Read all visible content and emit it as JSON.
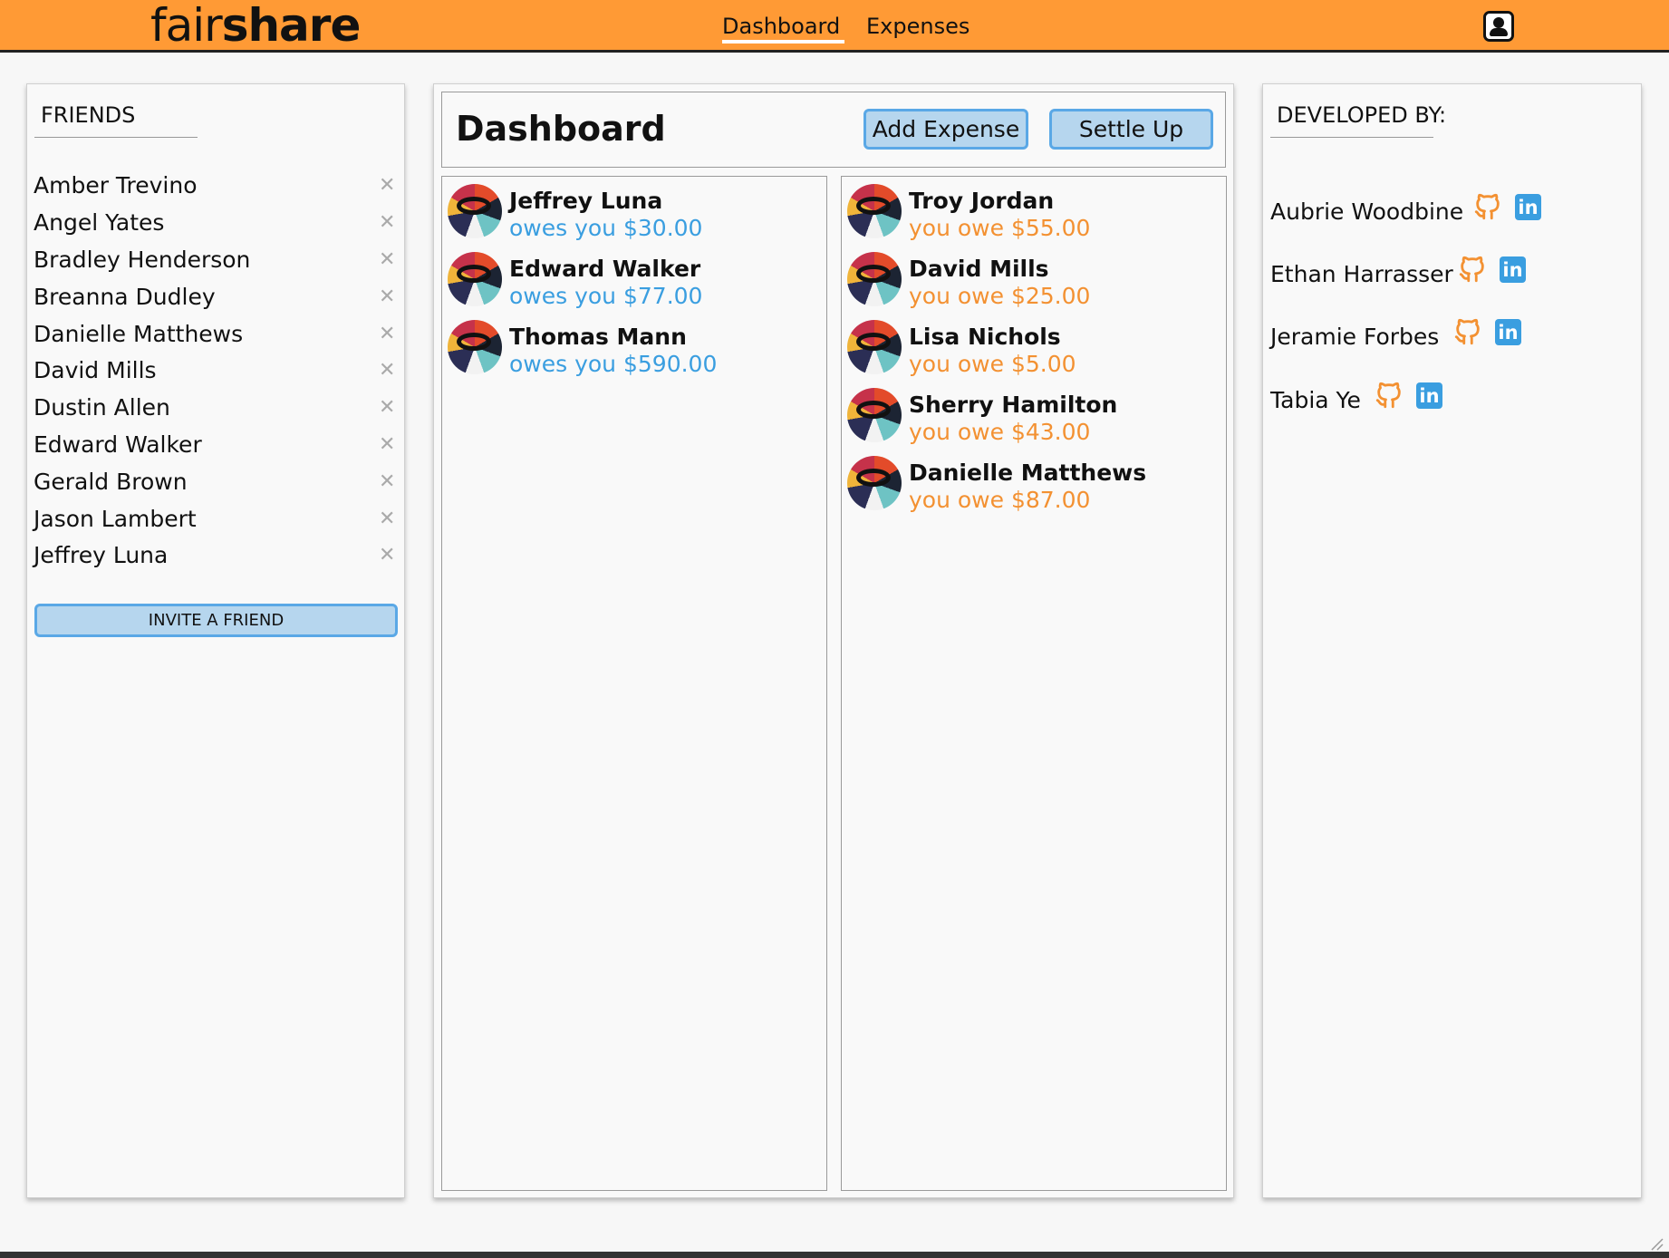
{
  "header": {
    "logo_light": "fair",
    "logo_bold": "share",
    "nav": [
      "Dashboard",
      "Expenses"
    ],
    "active_nav": "Dashboard",
    "account_icon": "user-circle-icon",
    "background": "#ff9a35"
  },
  "friends": {
    "title": "FRIENDS",
    "items": [
      "Amber Trevino",
      "Angel Yates",
      "Bradley Henderson",
      "Breanna Dudley",
      "Danielle Matthews",
      "David Mills",
      "Dustin Allen",
      "Edward Walker",
      "Gerald Brown",
      "Jason Lambert",
      "Jeffrey Luna"
    ],
    "remove_glyph": "✕",
    "invite_label": "INVITE A FRIEND"
  },
  "dashboard": {
    "title": "Dashboard",
    "add_expense_label": "Add Expense",
    "settle_up_label": "Settle Up",
    "owed_to_you": [
      {
        "name": "Jeffrey Luna",
        "amount": "owes you $30.00"
      },
      {
        "name": "Edward Walker",
        "amount": "owes you $77.00"
      },
      {
        "name": "Thomas Mann",
        "amount": "owes you $590.00"
      }
    ],
    "you_owe": [
      {
        "name": "Troy Jordan",
        "amount": "you owe $55.00"
      },
      {
        "name": "David Mills",
        "amount": "you owe $25.00"
      },
      {
        "name": "Lisa Nichols",
        "amount": "you owe $5.00"
      },
      {
        "name": "Sherry Hamilton",
        "amount": "you owe $43.00"
      },
      {
        "name": "Danielle Matthews",
        "amount": "you owe $87.00"
      }
    ],
    "colors": {
      "owed": "#3a9ee0",
      "owe": "#f39132"
    }
  },
  "developers": {
    "title": "DEVELOPED BY:",
    "items": [
      {
        "name": "Aubrie Woodbine",
        "icons": [
          "github-icon",
          "linkedin-icon"
        ]
      },
      {
        "name": "Ethan Harrasser",
        "icons": [
          "github-icon",
          "linkedin-icon"
        ]
      },
      {
        "name": "Jeramie Forbes",
        "icons": [
          "github-icon",
          "linkedin-icon"
        ]
      },
      {
        "name": "Tabia Ye",
        "icons": [
          "github-icon",
          "linkedin-icon"
        ]
      }
    ],
    "linkedin_text": "in"
  }
}
